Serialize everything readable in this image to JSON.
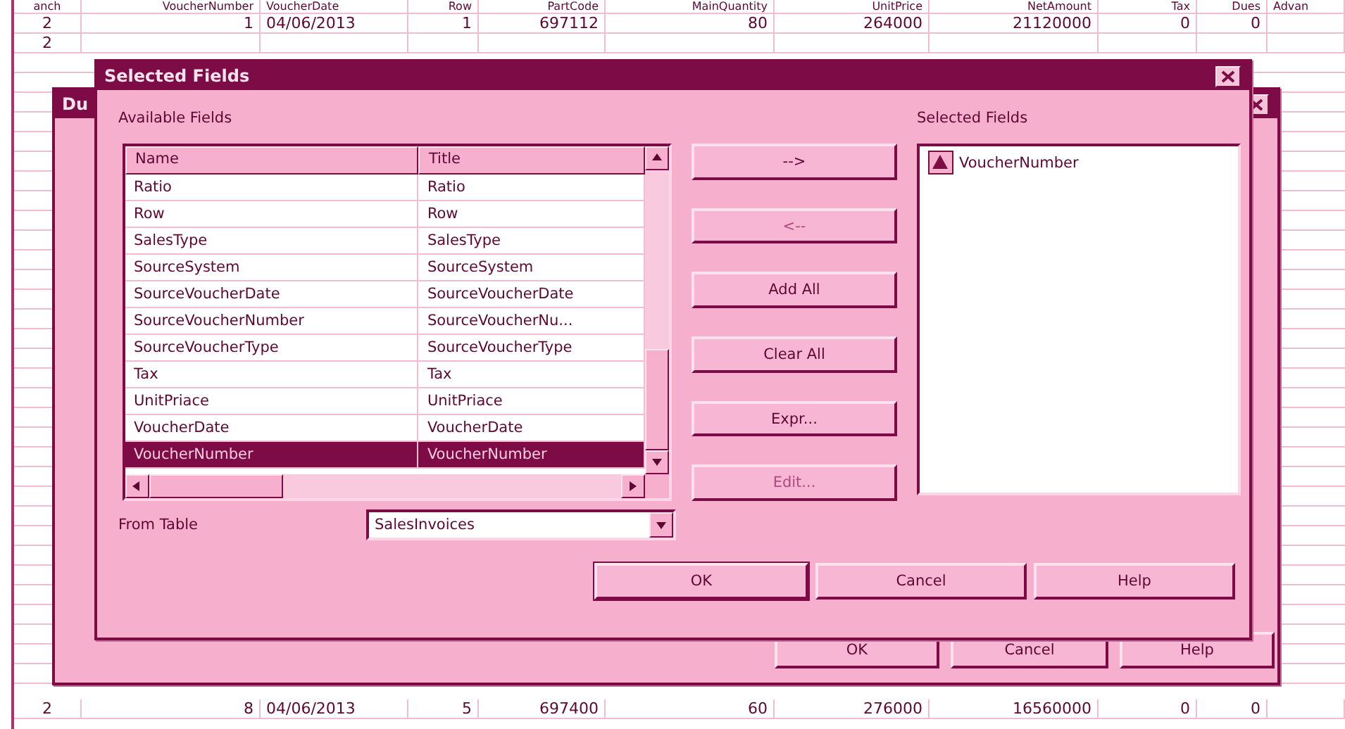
{
  "grid": {
    "columns": [
      "anch",
      "VoucherNumber",
      "VoucherDate",
      "Row",
      "PartCode",
      "MainQuantity",
      "UnitPrice",
      "NetAmount",
      "Tax",
      "Dues",
      "Advan"
    ],
    "top_rows": [
      {
        "cells": [
          "2",
          "1",
          "04/06/2013",
          "1",
          "697112",
          "80",
          "264000",
          "21120000",
          "0",
          "0",
          ""
        ]
      },
      {
        "cells": [
          "2"
        ]
      }
    ],
    "bottom_rows": [
      {
        "cells": [
          "2",
          "8",
          "04/06/2013",
          "5",
          "697400",
          "60",
          "276000",
          "16560000",
          "0",
          "0",
          ""
        ]
      }
    ]
  },
  "back_dialog": {
    "title": "Du",
    "buttons": [
      "OK",
      "Cancel",
      "Help"
    ]
  },
  "dialog": {
    "title": "Selected Fields",
    "available_label": "Available Fields",
    "available": {
      "columns": [
        "Name",
        "Title"
      ],
      "rows": [
        {
          "name": "Ratio",
          "title": "Ratio",
          "selected": false
        },
        {
          "name": "Row",
          "title": "Row",
          "selected": false
        },
        {
          "name": "SalesType",
          "title": "SalesType",
          "selected": false
        },
        {
          "name": "SourceSystem",
          "title": "SourceSystem",
          "selected": false
        },
        {
          "name": "SourceVoucherDate",
          "title": "SourceVoucherDate",
          "selected": false
        },
        {
          "name": "SourceVoucherNumber",
          "title": "SourceVoucherNu...",
          "selected": false
        },
        {
          "name": "SourceVoucherType",
          "title": "SourceVoucherType",
          "selected": false
        },
        {
          "name": "Tax",
          "title": "Tax",
          "selected": false
        },
        {
          "name": "UnitPriace",
          "title": "UnitPriace",
          "selected": false
        },
        {
          "name": "VoucherDate",
          "title": "VoucherDate",
          "selected": false
        },
        {
          "name": "VoucherNumber",
          "title": "VoucherNumber",
          "selected": true
        }
      ]
    },
    "move_buttons": [
      {
        "label": "-->",
        "disabled": false
      },
      {
        "label": "<--",
        "disabled": true
      },
      {
        "label": "Add All",
        "disabled": false
      },
      {
        "label": "Clear All",
        "disabled": false
      },
      {
        "label": "Expr...",
        "disabled": false
      },
      {
        "label": "Edit...",
        "disabled": true
      }
    ],
    "selected_label": "Selected Fields",
    "selected_fields": [
      {
        "label": "VoucherNumber",
        "ascending": true
      }
    ],
    "from_table": {
      "label": "From Table",
      "value": "SalesInvoices"
    },
    "buttons": [
      {
        "label": "OK",
        "default": true
      },
      {
        "label": "Cancel",
        "default": false
      },
      {
        "label": "Help",
        "default": false
      }
    ]
  }
}
